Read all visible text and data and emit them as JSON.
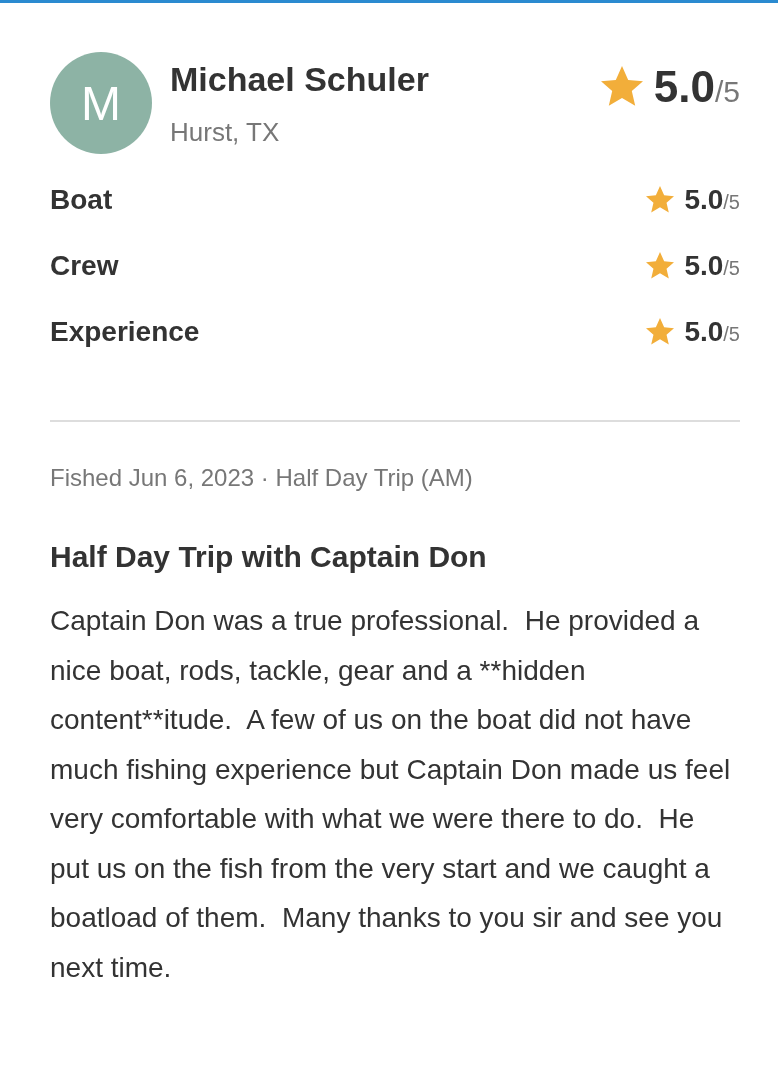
{
  "reviewer": {
    "initial": "M",
    "name": "Michael Schuler",
    "location": "Hurst, TX"
  },
  "overall": {
    "score": "5.0",
    "out_of": "/5"
  },
  "categories": [
    {
      "label": "Boat",
      "score": "5.0",
      "out_of": "/5"
    },
    {
      "label": "Crew",
      "score": "5.0",
      "out_of": "/5"
    },
    {
      "label": "Experience",
      "score": "5.0",
      "out_of": "/5"
    }
  ],
  "trip_info": "Fished Jun 6, 2023 · Half Day Trip (AM)",
  "title": "Half Day Trip with Captain Don",
  "body": "Captain Don was a true professional.  He provided a nice boat, rods, tackle, gear and a **hidden content**itude.  A few of us on the boat did not have much fishing experience but Captain Don made us feel very comfortable with what we were there to do.  He put us on the fish from the very start and we caught a boatload of them.  Many thanks to you sir and see you next time."
}
